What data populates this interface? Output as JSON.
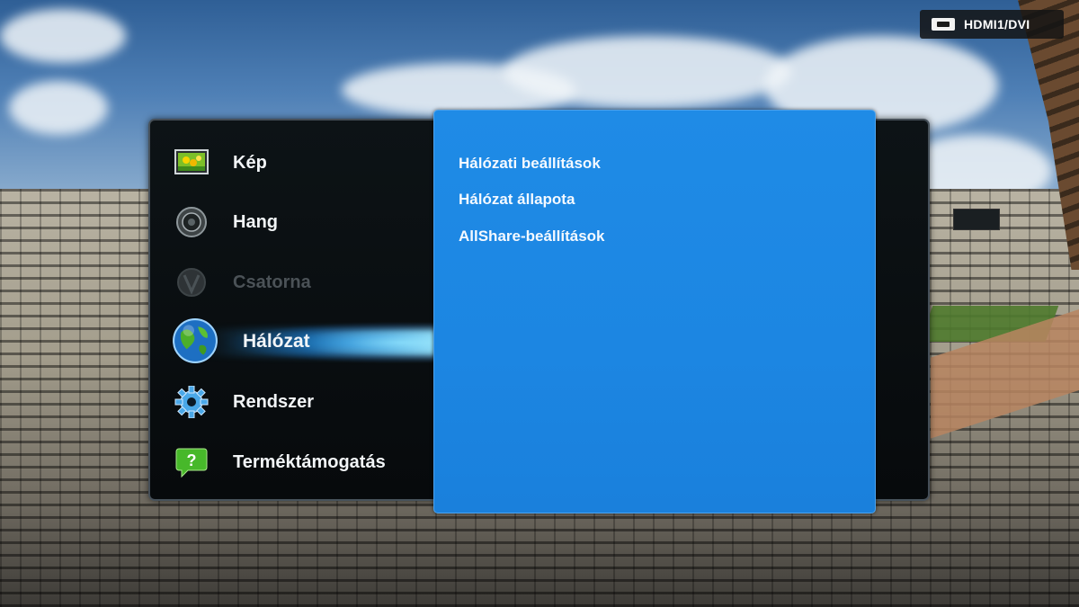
{
  "source": {
    "icon": "hdmi-icon",
    "label": "HDMI1/DVI"
  },
  "menu": {
    "items": [
      {
        "label": "Kép",
        "icon": "picture-icon",
        "state": "normal"
      },
      {
        "label": "Hang",
        "icon": "speaker-icon",
        "state": "normal"
      },
      {
        "label": "Csatorna",
        "icon": "antenna-icon",
        "state": "disabled"
      },
      {
        "label": "Hálózat",
        "icon": "globe-icon",
        "state": "selected"
      },
      {
        "label": "Rendszer",
        "icon": "gear-icon",
        "state": "normal"
      },
      {
        "label": "Terméktámogatás",
        "icon": "help-icon",
        "state": "normal"
      }
    ]
  },
  "submenu": {
    "items": [
      "Hálózati beállítások",
      "Hálózat állapota",
      "AllShare-beállítások"
    ]
  },
  "colors": {
    "submenu_bg": "#1f8be6",
    "highlight_beam": "#5fd0ff",
    "disabled_text": "#4b5257"
  }
}
